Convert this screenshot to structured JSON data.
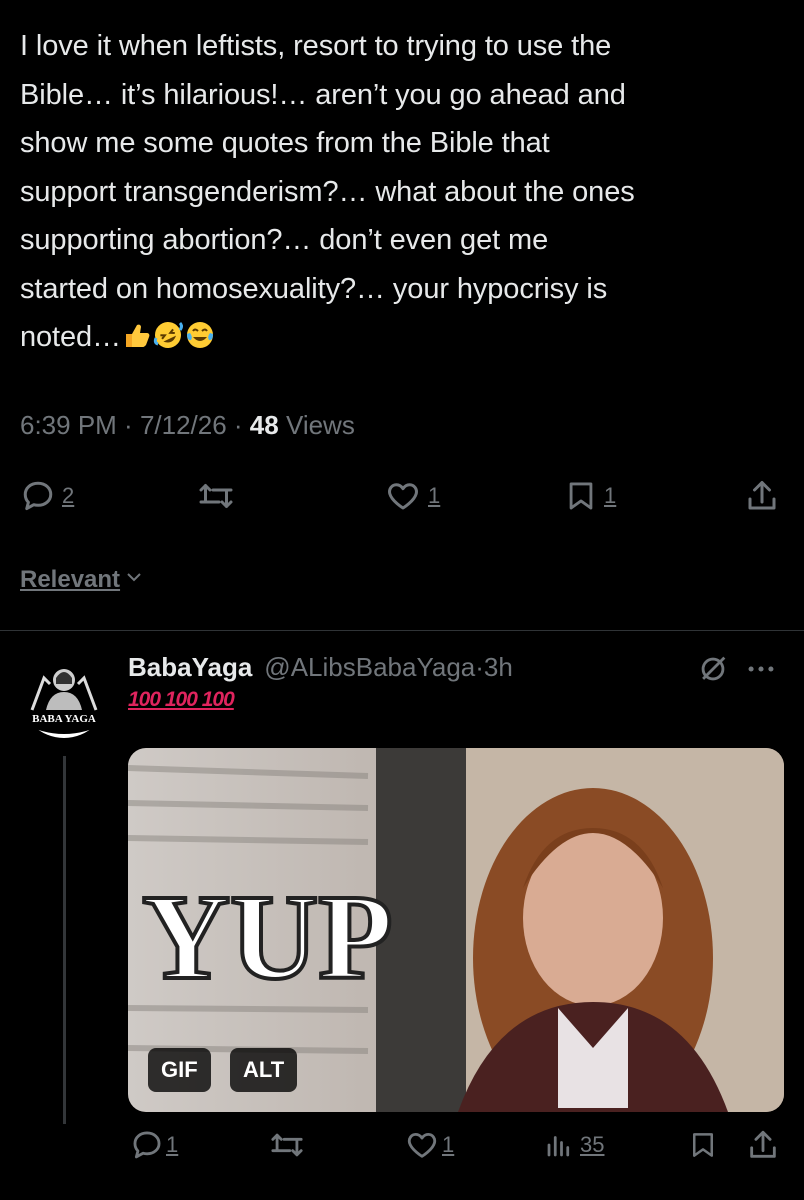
{
  "tweet": {
    "text": "I love it when leftists, resort to trying to use the\nBible… it’s hilarious!… aren’t you go ahead and\nshow me some quotes from the Bible that\nsupport transgenderism?… what about the ones\nsupporting abortion?… don’t even get me\nstarted on homosexuality?… your hypocrisy is\nnoted…",
    "emojis": [
      "thumbs-up-emoji",
      "rolling-on-floor-laughing-emoji",
      "tears-of-joy-emoji"
    ],
    "time": "6:39 PM",
    "date": "7/12/26",
    "sep": " · ",
    "views_count": "48",
    "views_label": "Views",
    "replies": "2",
    "likes": "1",
    "bookmarks": "1"
  },
  "sort": {
    "label": "Relevant"
  },
  "reply": {
    "name": "BabaYaga",
    "handle": "@ALibsBabaYaga",
    "time": "3h",
    "sep": "·",
    "text": "100 100 100",
    "avatar_text": "BABA YAGA",
    "media": {
      "caption": "YUP",
      "gif_label": "GIF",
      "alt_label": "ALT"
    },
    "replies": "1",
    "likes": "1",
    "views": "35"
  },
  "colors": {
    "background": "#000000",
    "text": "#e7e9ea",
    "muted": "#71767b",
    "divider": "#2f3336",
    "hundred_red": "#e0245e"
  }
}
